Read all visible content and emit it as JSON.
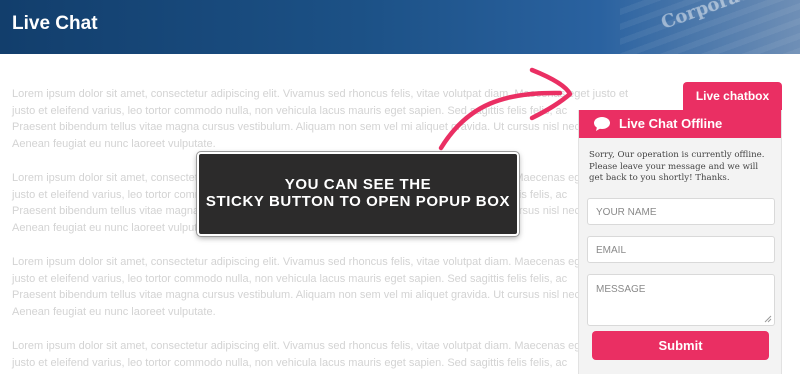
{
  "header": {
    "title": "Live Chat",
    "decor_text": "Corporate"
  },
  "content": {
    "paragraphs": [
      [
        "Lorem ipsum dolor sit amet, consectetur adipiscing elit. Vivamus sed rhoncus felis, vitae volutpat diam. Maecenas eget justo et",
        "justo et eleifend varius, leo tortor commodo nulla, non vehicula lacus mauris eget sapien. Sed sagittis felis felis, ac",
        "Praesent bibendum tellus vitae magna cursus vestibulum. Aliquam non sem vel mi aliquet gravida. Ut cursus nisl nec",
        "Aenean feugiat eu nunc laoreet vulputate."
      ],
      [
        "Lorem ipsum dolor sit amet, consectetur adipiscing elit. Vivamus sed rhoncus felis, vitae volutpat diam. Maecenas eget justo et",
        "justo et eleifend varius, leo tortor commodo nulla, non vehicula lacus mauris eget sapien. Sed sagittis felis felis, ac",
        "Praesent bibendum tellus vitae magna cursus vestibulum. Aliquam non sem vel mi aliquet gravida. Ut cursus nisl nec",
        "Aenean feugiat eu nunc laoreet vulputate."
      ],
      [
        "Lorem ipsum dolor sit amet, consectetur adipiscing elit. Vivamus sed rhoncus felis, vitae volutpat diam. Maecenas eget justo et",
        "justo et eleifend varius, leo tortor commodo nulla, non vehicula lacus mauris eget sapien. Sed sagittis felis felis, ac",
        "Praesent bibendum tellus vitae magna cursus vestibulum. Aliquam non sem vel mi aliquet gravida. Ut cursus nisl nec",
        "Aenean feugiat eu nunc laoreet vulputate."
      ],
      [
        "Lorem ipsum dolor sit amet, consectetur adipiscing elit. Vivamus sed rhoncus felis, vitae volutpat diam. Maecenas eget justo et",
        "justo et eleifend varius, leo tortor commodo nulla, non vehicula lacus mauris eget sapien. Sed sagittis felis felis, ac"
      ]
    ]
  },
  "callout": {
    "line1": "YOU CAN SEE THE",
    "line2": "STICKY BUTTON TO OPEN POPUP BOX"
  },
  "chat": {
    "tab_label": "Live chatbox",
    "header_title": "Live Chat Offline",
    "header_icon": "speech-bubble-icon",
    "message": "Sorry, Our operation is currently offline. Please leave your message and we will get back to you shortly! Thanks.",
    "name_placeholder": "YOUR NAME",
    "email_placeholder": "EMAIL",
    "message_placeholder": "MESSAGE",
    "submit_label": "Submit"
  },
  "colors": {
    "accent": "#ea2f63",
    "header_bg": "#1c5186",
    "callout_bg": "#2c2b2b",
    "muted_text": "#d3d3d3"
  }
}
